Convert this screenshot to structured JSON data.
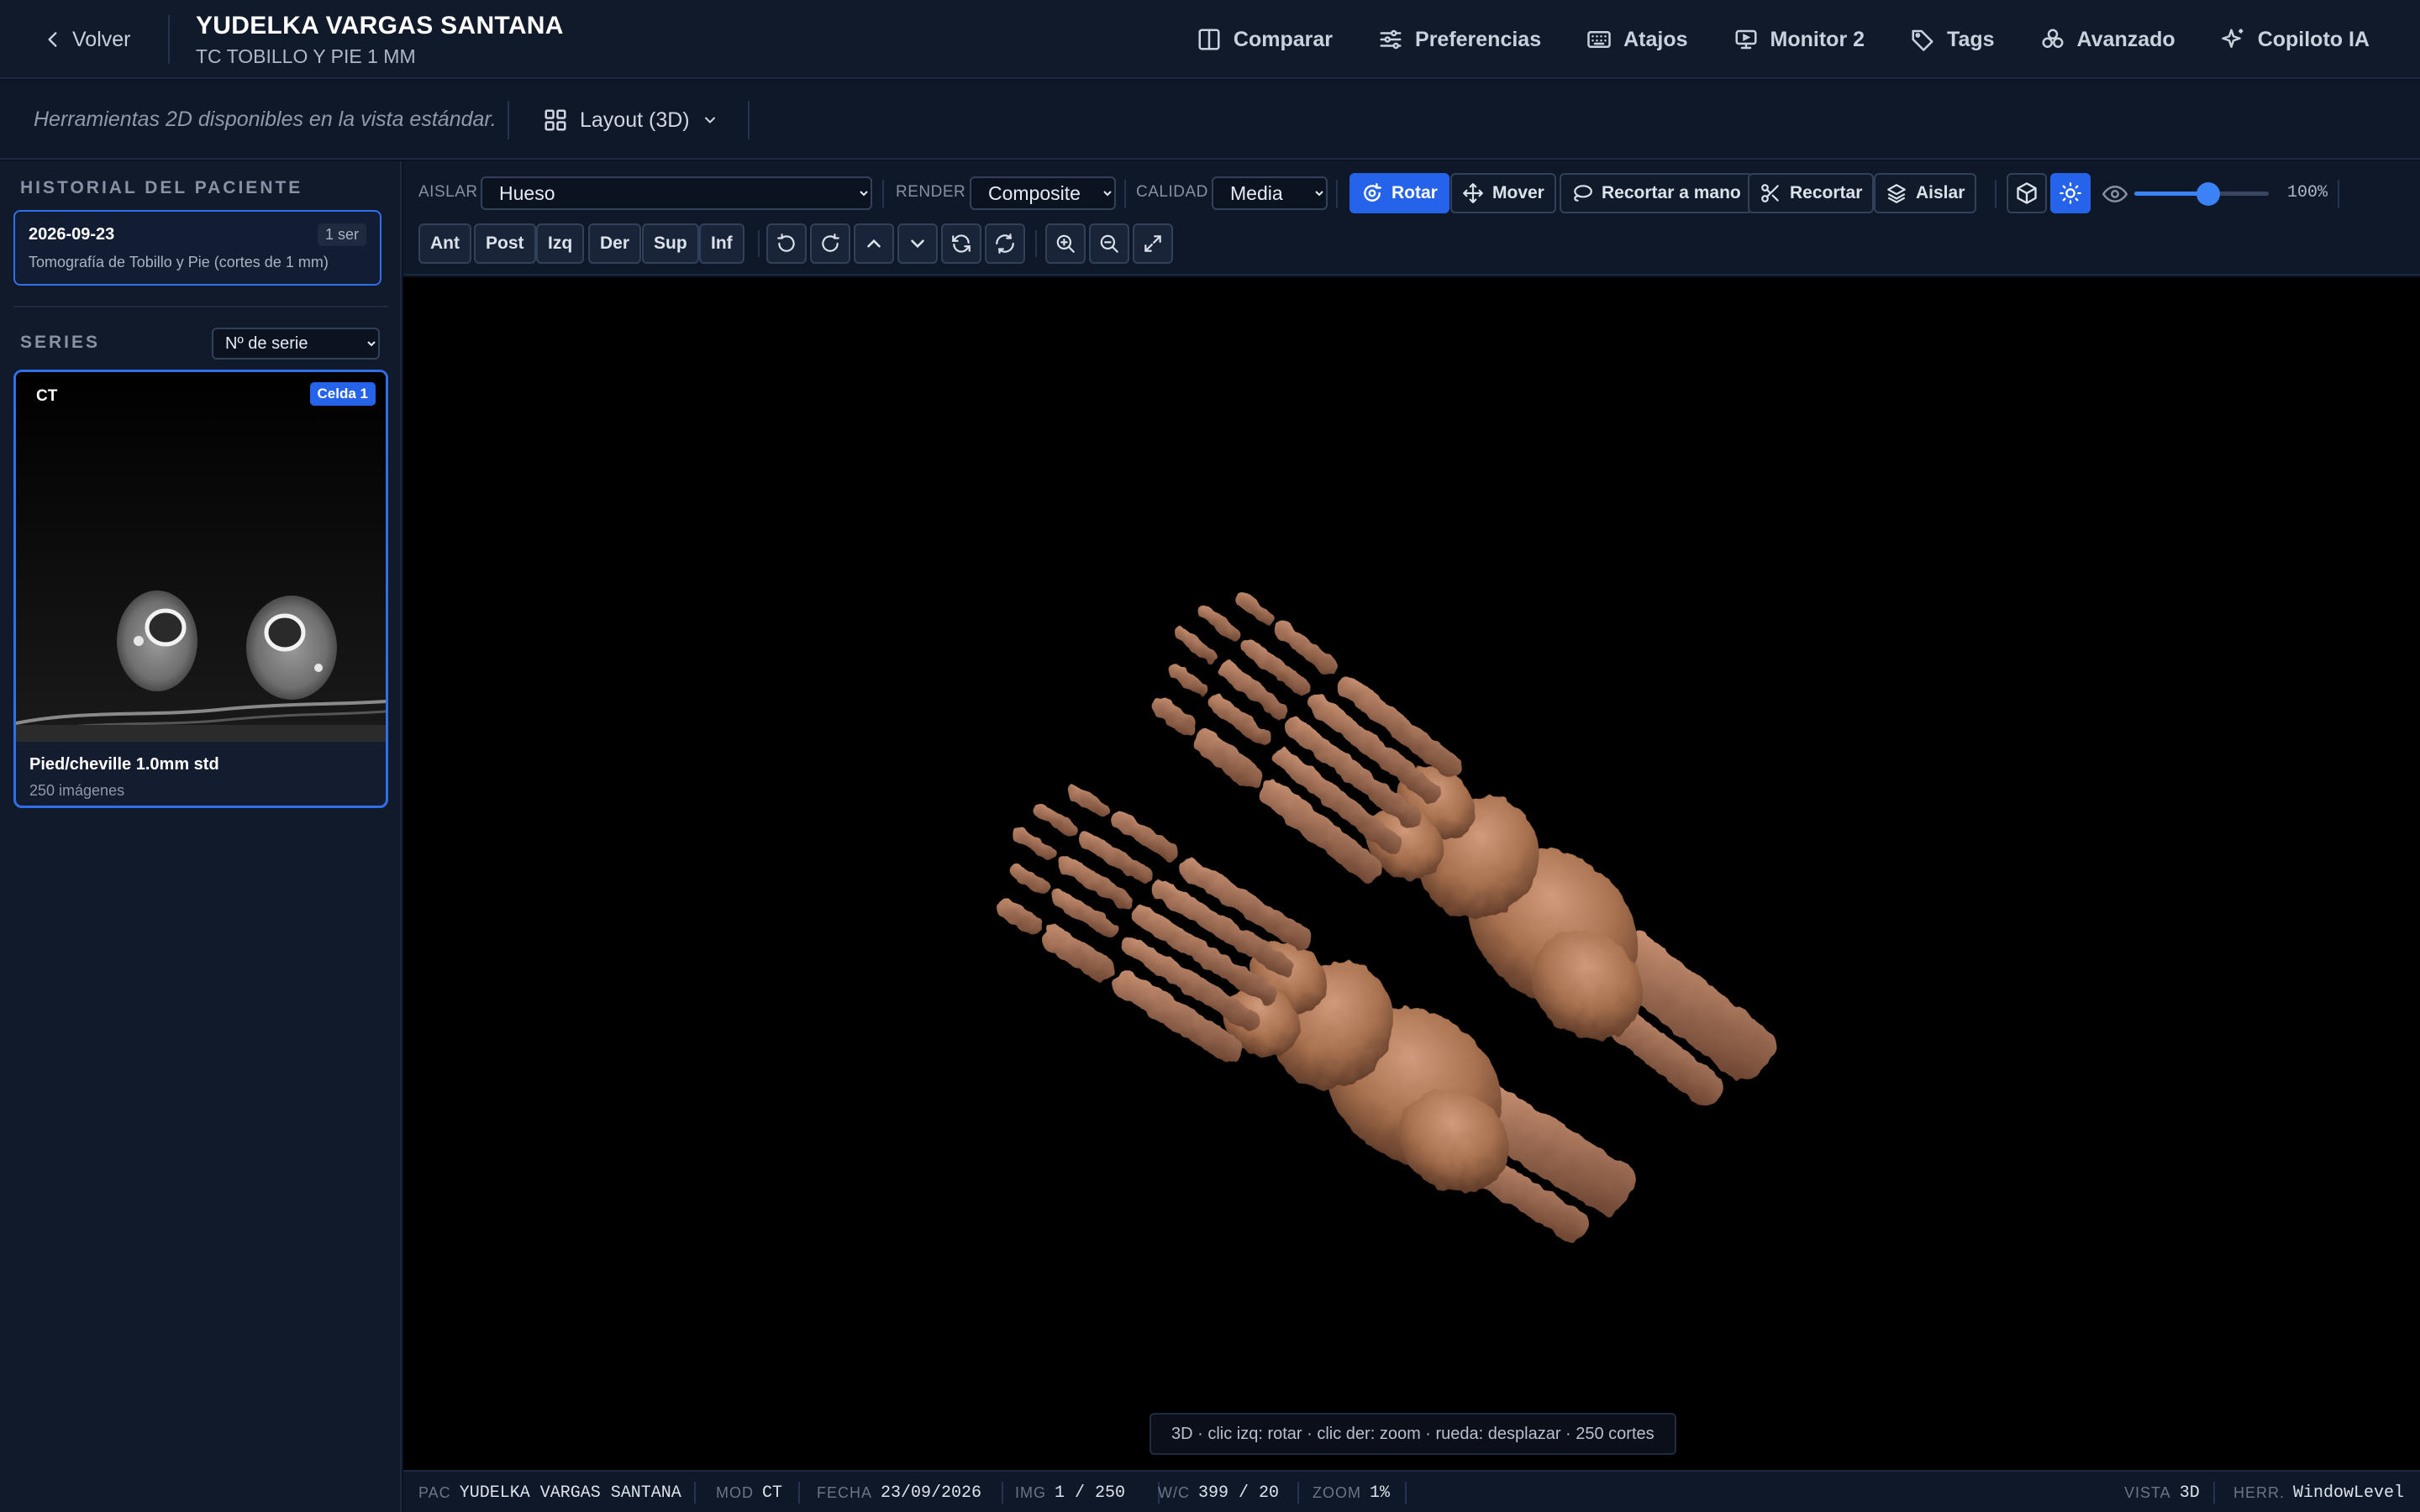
{
  "header": {
    "back_label": "Volver",
    "patient_name": "YUDELKA VARGAS SANTANA",
    "study_description": "TC TOBILLO Y PIE 1 MM",
    "actions": [
      {
        "label": "Comparar",
        "icon": "columns-icon"
      },
      {
        "label": "Preferencias",
        "icon": "sliders-icon"
      },
      {
        "label": "Atajos",
        "icon": "keyboard-icon"
      },
      {
        "label": "Monitor 2",
        "icon": "monitor-icon"
      },
      {
        "label": "Tags",
        "icon": "tag-icon"
      },
      {
        "label": "Avanzado",
        "icon": "molecule-icon"
      },
      {
        "label": "Copiloto IA",
        "icon": "sparkle-icon"
      }
    ]
  },
  "subbar": {
    "hint_2d": "Herramientas 2D disponibles en la vista estándar.",
    "layout_label": "Layout (3D)"
  },
  "sidebar": {
    "history_title": "HISTORIAL DEL PACIENTE",
    "history": {
      "date": "2026-09-23",
      "badge": "1 ser",
      "description": "Tomografía de Tobillo y Pie (cortes de 1 mm)"
    },
    "series_title": "SERIES",
    "series_sort": "Nº de serie",
    "series": {
      "modality": "CT",
      "cell_badge": "Celda 1",
      "name": "Pied/cheville 1.0mm std",
      "count": "250 imágenes"
    }
  },
  "toolbar": {
    "isolate_label": "AISLAR",
    "isolate_value": "Hueso",
    "render_label": "RENDER",
    "render_value": "Composite",
    "quality_label": "CALIDAD",
    "quality_value": "Media",
    "tools": {
      "rotate": "Rotar",
      "move": "Mover",
      "freehand_crop": "Recortar a mano",
      "crop": "Recortar",
      "isolate": "Aislar"
    },
    "opacity_value": "100%",
    "opacity_fraction": 0.55,
    "views": [
      "Ant",
      "Post",
      "Izq",
      "Der",
      "Sup",
      "Inf"
    ]
  },
  "viewport": {
    "hint": "3D · clic izq: rotar · clic der: zoom · rueda: desplazar · 250 cortes"
  },
  "status": {
    "pac_key": "PAC",
    "pac_val": "YUDELKA VARGAS SANTANA",
    "mod_key": "MOD",
    "mod_val": "CT",
    "fecha_key": "FECHA",
    "fecha_val": "23/09/2026",
    "img_key": "IMG",
    "img_val": "1 / 250",
    "wc_key": "W/C",
    "wc_val": "399 / 20",
    "zoom_key": "ZOOM",
    "zoom_val": "1%",
    "vista_key": "VISTA",
    "vista_val": "3D",
    "herr_key": "HERR.",
    "herr_val": "WindowLevel"
  },
  "colors": {
    "accent": "#2563eb",
    "bone": "#b07a5e"
  }
}
